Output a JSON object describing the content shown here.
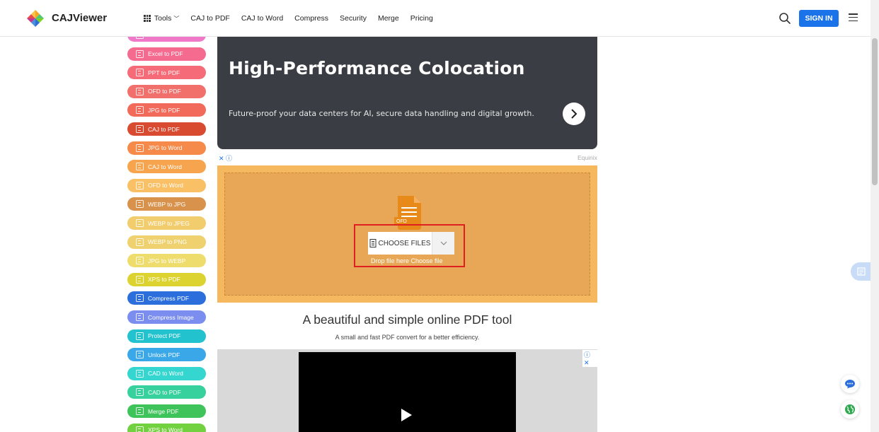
{
  "header": {
    "brand": "CAJViewer",
    "nav": [
      "Tools",
      "CAJ to PDF",
      "CAJ to Word",
      "Compress",
      "Security",
      "Merge",
      "Pricing"
    ],
    "signin_label": "SIGN IN",
    "accent": "#1a73e8"
  },
  "sidebar": {
    "items": [
      {
        "label": "",
        "color": "#f078c8"
      },
      {
        "label": "Excel to PDF",
        "color": "#f56b8f"
      },
      {
        "label": "PPT to PDF",
        "color": "#f56b78"
      },
      {
        "label": "OFD to PDF",
        "color": "#f2706c"
      },
      {
        "label": "JPG to PDF",
        "color": "#f26a5a"
      },
      {
        "label": "CAJ to PDF",
        "color": "#d94b30"
      },
      {
        "label": "JPG to Word",
        "color": "#f58a4a"
      },
      {
        "label": "CAJ to Word",
        "color": "#f7a44e"
      },
      {
        "label": "OFD to Word",
        "color": "#f9c066"
      },
      {
        "label": "WEBP to JPG",
        "color": "#d9924c"
      },
      {
        "label": "WEBP to JPEG",
        "color": "#f2cd6e"
      },
      {
        "label": "WEBP to PNG",
        "color": "#efd26f"
      },
      {
        "label": "JPG to WEBP",
        "color": "#eedc6c"
      },
      {
        "label": "XPS to PDF",
        "color": "#dcd331"
      },
      {
        "label": "Compress PDF",
        "color": "#2c6fdc"
      },
      {
        "label": "Compress Image",
        "color": "#7b8ef0"
      },
      {
        "label": "Protect PDF",
        "color": "#22c2cf"
      },
      {
        "label": "Unlock PDF",
        "color": "#3aa8e8"
      },
      {
        "label": "CAD to Word",
        "color": "#35d6d0"
      },
      {
        "label": "CAD to PDF",
        "color": "#37d19e"
      },
      {
        "label": "Merge PDF",
        "color": "#3ec45a"
      },
      {
        "label": "XPS to Word",
        "color": "#72d13e"
      }
    ]
  },
  "ad": {
    "title": "High-Performance Colocation",
    "subtitle": "Future-proof your data centers for AI, secure data handling and digital growth.",
    "source": "Equinix",
    "close": "✕ ⓘ",
    "bg": "#3a3d43"
  },
  "upload": {
    "file_tag": "OFD",
    "choose_label": "CHOOSE FILES",
    "drop_text": "Drop file here Choose file",
    "bg": "#f5b85f"
  },
  "main": {
    "heading": "A beautiful and simple online PDF tool",
    "subheading": "A small and fast PDF convert for a better efficiency."
  },
  "video_ad": {
    "controls": "ⓘ ✕"
  }
}
